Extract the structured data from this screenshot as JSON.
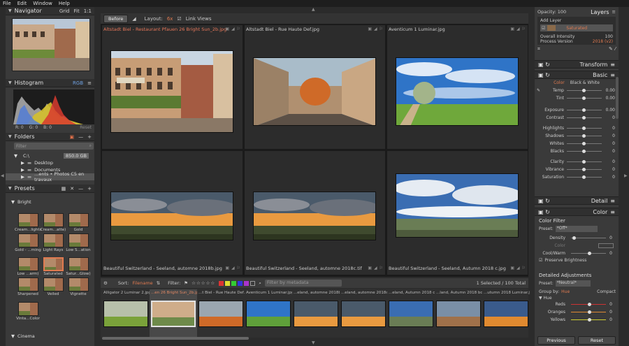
{
  "menubar": {
    "items": [
      "File",
      "Edit",
      "Window",
      "Help"
    ]
  },
  "navigator": {
    "title": "Navigator",
    "options": [
      "Grid",
      "Fit",
      "1:1"
    ]
  },
  "histogram": {
    "title": "Histogram",
    "mode": "RGB",
    "r": "R: 0",
    "g": "G: 0",
    "b": "B: 0",
    "reset": "Reset"
  },
  "folders": {
    "title": "Folders",
    "filter_placeholder": "Filter",
    "drive": "C:\\",
    "drive_size": "850.0 GB",
    "items": [
      "Desktop",
      "Documents",
      "...ents • Photos C5 en travaux"
    ]
  },
  "presets": {
    "title": "Presets",
    "group": "Bright",
    "group2": "Cinema",
    "items": [
      "Cream...lights",
      "Cream...atte)",
      "Gold",
      "Gold - ...rning",
      "Light Rays",
      "Low S...ation",
      "Low ...arm)",
      "Saturated",
      "Satur...Glow)",
      "Sharpened",
      "Veiled",
      "Vignette",
      "Vinta...Color"
    ]
  },
  "toolbar": {
    "before": "Before",
    "layout_label": "Layout:",
    "layout_value": "6x",
    "link_views": "Link Views"
  },
  "grid": {
    "captions": [
      "Altstadt Biel - Restaurant Pfauen 26 Bright Sun_2b.jpg",
      "Altstadt Biel - Rue Haute Def.jpg",
      "Aventicum 1 Luminar.jpg",
      "Beautiful Switzerland - Seeland, automne 2018b.jpg",
      "Beautiful Switzerland - Seeland, automne 2018c.tif",
      "Beautiful Switzerland - Seeland, Autumn 2018 c.jpg"
    ]
  },
  "sortbar": {
    "sort": "Sort:",
    "sort_value": "Filename",
    "filter": "Filter:",
    "filter_placeholder": "Filter by metadata",
    "status": "1 Selected / 100 Total"
  },
  "filmstrip": {
    "captions": [
      "Alligator 2 Luminar 2.jpg",
      "...en 26 Bright Sun_2b.jpg",
      "...t Biel - Rue Haute Def.jpg",
      "Aventicum 1 Luminar.jpg",
      "...eland, automne 2018b.jpg",
      "...eland, automne 2018c.tif",
      "...eland, Autumn 2018 c.jpg",
      "...land, Autumn 2018 bc.jpg",
      "...utumn 2018 Luminar.jpg"
    ]
  },
  "layers": {
    "title": "Layers",
    "opacity": "Opacity: 100",
    "add_layer": "Add Layer",
    "layer_name": "Saturated",
    "overall_intensity": "Overall Intensity",
    "intensity_value": "100",
    "process_version": "Process Version",
    "process_value": "2018 (v2)"
  },
  "transform": {
    "title": "Transform"
  },
  "basic": {
    "title": "Basic",
    "tabs": [
      "Color",
      "Black & White"
    ],
    "sliders": [
      {
        "label": "Temp",
        "value": "0.00"
      },
      {
        "label": "Tint",
        "value": "0.00"
      },
      {
        "label": "Exposure",
        "value": "0.00"
      },
      {
        "label": "Contrast",
        "value": "0"
      },
      {
        "label": "Highlights",
        "value": "0"
      },
      {
        "label": "Shadows",
        "value": "0"
      },
      {
        "label": "Whites",
        "value": "0"
      },
      {
        "label": "Blacks",
        "value": "0"
      },
      {
        "label": "Clarity",
        "value": "0"
      },
      {
        "label": "Vibrance",
        "value": "0"
      },
      {
        "label": "Saturation",
        "value": "0"
      }
    ]
  },
  "detail": {
    "title": "Detail"
  },
  "color": {
    "title": "Color",
    "filter_label": "Color Filter",
    "preset_label": "Preset:",
    "preset_value": "*Off*",
    "density": "Density",
    "density_val": "0",
    "color": "Color",
    "coolwarm": "Cool/Warm",
    "coolwarm_val": "0",
    "preserve": "Preserve Brightness"
  },
  "detailed": {
    "title": "Detailed Adjustments",
    "preset_label": "Preset:",
    "preset_value": "*Neutral*",
    "group_label": "Group by:",
    "group_value": "Hue",
    "compact": "Compact",
    "hue": "Hue",
    "reds": "Reds",
    "reds_val": "0",
    "oranges": "Oranges",
    "oranges_val": "0",
    "yellows": "Yellows",
    "yellows_val": "0"
  },
  "footer": {
    "previous": "Previous",
    "reset": "Reset"
  }
}
